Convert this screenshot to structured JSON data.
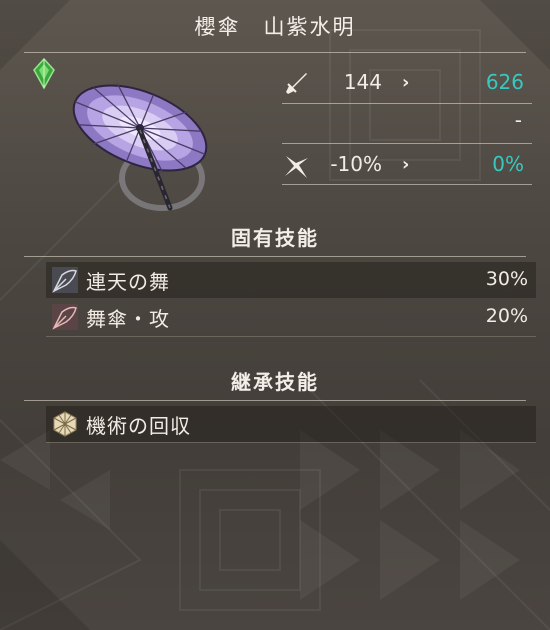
{
  "item": {
    "title": "櫻傘　山紫水明",
    "rarity_icon": "green-gem-icon",
    "image": "purple-umbrella-icon"
  },
  "stats": [
    {
      "icon": "sword-icon",
      "base": "144",
      "arrow": "›",
      "new": "626"
    },
    {
      "icon": "",
      "base": "",
      "arrow": "",
      "new": "-"
    },
    {
      "icon": "critical-spark-icon",
      "base": "-10%",
      "arrow": "›",
      "new": "0%"
    }
  ],
  "unique_skills": {
    "heading": "固有技能",
    "items": [
      {
        "icon": "umbrella-skill-icon",
        "name": "連天の舞",
        "value": "30%"
      },
      {
        "icon": "umbrella-skill-icon",
        "name": "舞傘・攻",
        "value": "20%"
      }
    ]
  },
  "inherit_skills": {
    "heading": "継承技能",
    "items": [
      {
        "icon": "hemp-leaf-emblem-icon",
        "name": "機術の回収",
        "value": ""
      }
    ]
  },
  "colors": {
    "upgrade": "#38c8c0",
    "text": "#f1ece4",
    "rarity": "#4fc24a",
    "umbrella": "#9c84d6"
  }
}
